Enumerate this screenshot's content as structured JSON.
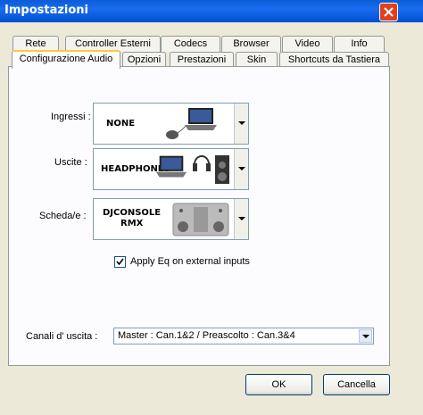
{
  "window": {
    "title": "Impostazioni"
  },
  "tabs_row1": [
    "Rete",
    "Controller Esterni",
    "Codecs",
    "Browser",
    "Video",
    "Info"
  ],
  "tabs_row2": [
    "Configurazione Audio",
    "Opzioni",
    "Prestazioni",
    "Skin",
    "Shortcuts da Tastiera"
  ],
  "active_tab": "Configurazione Audio",
  "audio": {
    "ingressi_label": "Ingressi :",
    "ingressi_value": "NONE",
    "uscite_label": "Uscite :",
    "uscite_value": "HEADPHONES",
    "scheda_label": "Scheda/e :",
    "scheda_value_line1": "DJCONSOLE",
    "scheda_value_line2": "RMX",
    "apply_eq_label": "Apply Eq on external inputs",
    "apply_eq_checked": true,
    "canali_label": "Canali d' uscita :",
    "canali_value": "Master : Can.1&2 / Preascolto : Can.3&4"
  },
  "buttons": {
    "ok": "OK",
    "cancel": "Cancella"
  },
  "icons": [
    "close-icon",
    "laptop-icon",
    "mouse-icon",
    "headphones-icon",
    "speaker-icon",
    "dj-console-icon",
    "checkmark-icon",
    "chevron-down-icon"
  ],
  "colors": {
    "titlebar": "#0A5CD8",
    "close": "#E04020",
    "tab_highlight": "#FFC83C",
    "dialog_bg": "#ECE9D8"
  }
}
